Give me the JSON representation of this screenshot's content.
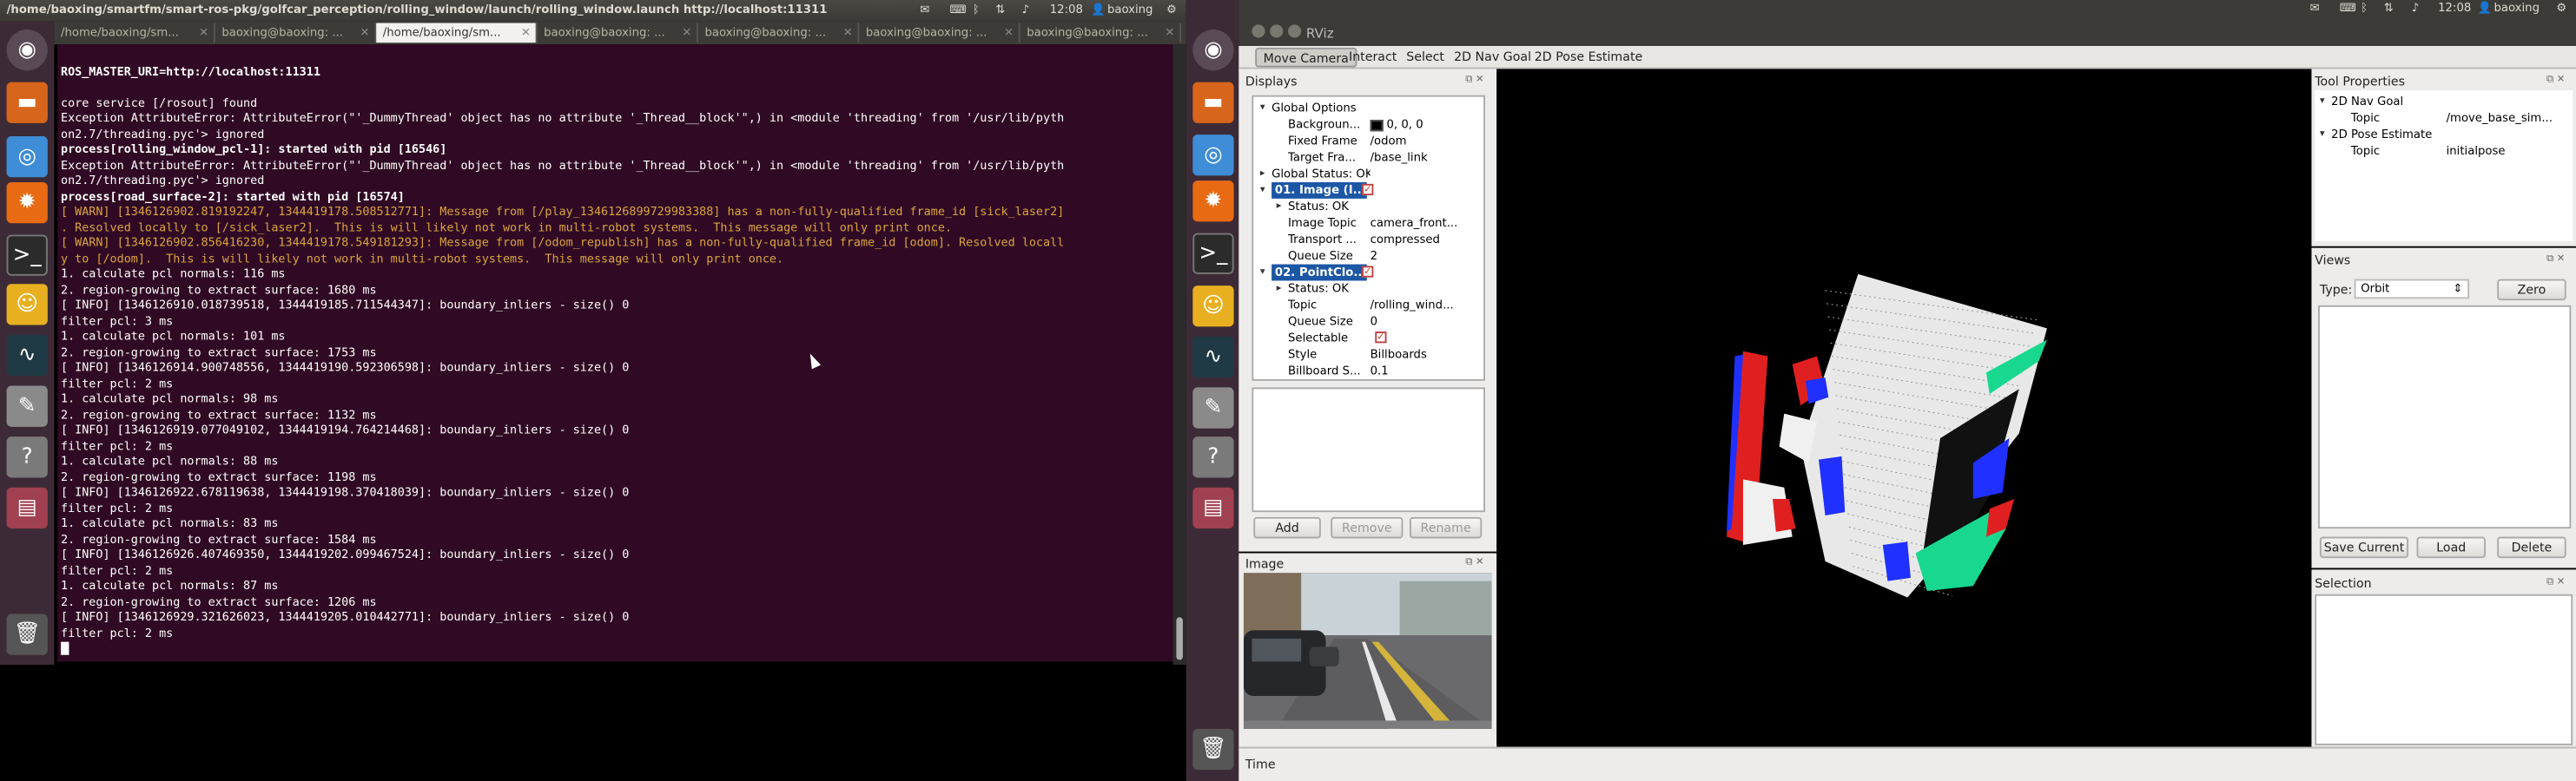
{
  "left_topbar": {
    "title": "/home/baoxing/smartfm/smart-ros-pkg/golfcar_perception/rolling_window/launch/rolling_window.launch http://localhost:11311",
    "time": "12:08",
    "user": "baoxing"
  },
  "right_topbar": {
    "time": "12:08",
    "user": "baoxing"
  },
  "terminal_tabs": [
    {
      "label": "/home/baoxing/sm..."
    },
    {
      "label": "baoxing@baoxing: ..."
    },
    {
      "label": "/home/baoxing/sm..."
    },
    {
      "label": "baoxing@baoxing: ..."
    },
    {
      "label": "baoxing@baoxing: ..."
    },
    {
      "label": "baoxing@baoxing: ..."
    },
    {
      "label": "baoxing@baoxing: ..."
    }
  ],
  "terminal_lines": [
    {
      "t": "",
      "s": ""
    },
    {
      "t": "ROS_MASTER_URI=http://localhost:11311",
      "s": "b"
    },
    {
      "t": "",
      "s": ""
    },
    {
      "t": "core service [/rosout] found",
      "s": ""
    },
    {
      "t": "Exception AttributeError: AttributeError(\"'_DummyThread' object has no attribute '_Thread__block'\",) in <module 'threading' from '/usr/lib/pyth",
      "s": ""
    },
    {
      "t": "on2.7/threading.pyc'> ignored",
      "s": ""
    },
    {
      "t": "process[rolling_window_pcl-1]: started with pid [16546]",
      "s": "b"
    },
    {
      "t": "Exception AttributeError: AttributeError(\"'_DummyThread' object has no attribute '_Thread__block'\",) in <module 'threading' from '/usr/lib/pyth",
      "s": ""
    },
    {
      "t": "on2.7/threading.pyc'> ignored",
      "s": ""
    },
    {
      "t": "process[road_surface-2]: started with pid [16574]",
      "s": "b"
    },
    {
      "t": "[ WARN] [1346126902.819192247, 1344419178.508512771]: Message from [/play_1346126899729983388] has a non-fully-qualified frame_id [sick_laser2]",
      "s": "w"
    },
    {
      "t": ". Resolved locally to [/sick_laser2].  This is will likely not work in multi-robot systems.  This message will only print once.",
      "s": "w"
    },
    {
      "t": "[ WARN] [1346126902.856416230, 1344419178.549181293]: Message from [/odom_republish] has a non-fully-qualified frame_id [odom]. Resolved locall",
      "s": "w"
    },
    {
      "t": "y to [/odom].  This is will likely not work in multi-robot systems.  This message will only print once.",
      "s": "w"
    },
    {
      "t": "1. calculate pcl normals: 116 ms",
      "s": ""
    },
    {
      "t": "2. region-growing to extract surface: 1680 ms",
      "s": ""
    },
    {
      "t": "[ INFO] [1346126910.018739518, 1344419185.711544347]: boundary_inliers - size() 0",
      "s": ""
    },
    {
      "t": "filter pcl: 3 ms",
      "s": ""
    },
    {
      "t": "1. calculate pcl normals: 101 ms",
      "s": ""
    },
    {
      "t": "2. region-growing to extract surface: 1753 ms",
      "s": ""
    },
    {
      "t": "[ INFO] [1346126914.900748556, 1344419190.592306598]: boundary_inliers - size() 0",
      "s": ""
    },
    {
      "t": "filter pcl: 2 ms",
      "s": ""
    },
    {
      "t": "1. calculate pcl normals: 98 ms",
      "s": ""
    },
    {
      "t": "2. region-growing to extract surface: 1132 ms",
      "s": ""
    },
    {
      "t": "[ INFO] [1346126919.077049102, 1344419194.764214468]: boundary_inliers - size() 0",
      "s": ""
    },
    {
      "t": "filter pcl: 2 ms",
      "s": ""
    },
    {
      "t": "1. calculate pcl normals: 88 ms",
      "s": ""
    },
    {
      "t": "2. region-growing to extract surface: 1198 ms",
      "s": ""
    },
    {
      "t": "[ INFO] [1346126922.678119638, 1344419198.370418039]: boundary_inliers - size() 0",
      "s": ""
    },
    {
      "t": "filter pcl: 2 ms",
      "s": ""
    },
    {
      "t": "1. calculate pcl normals: 83 ms",
      "s": ""
    },
    {
      "t": "2. region-growing to extract surface: 1584 ms",
      "s": ""
    },
    {
      "t": "[ INFO] [1346126926.407469350, 1344419202.099467524]: boundary_inliers - size() 0",
      "s": ""
    },
    {
      "t": "filter pcl: 2 ms",
      "s": ""
    },
    {
      "t": "1. calculate pcl normals: 87 ms",
      "s": ""
    },
    {
      "t": "2. region-growing to extract surface: 1206 ms",
      "s": ""
    },
    {
      "t": "[ INFO] [1346126929.321626023, 1344419205.010442771]: boundary_inliers - size() 0",
      "s": ""
    },
    {
      "t": "filter pcl: 2 ms",
      "s": ""
    }
  ],
  "rviz": {
    "window_title": "RViz",
    "tools": [
      "Move Camera",
      "Interact",
      "Select",
      "2D Nav Goal",
      "2D Pose Estimate"
    ],
    "displays": {
      "title": "Displays",
      "rows": [
        {
          "k": "Global Options",
          "v": "",
          "lvl": 0,
          "tri": "▾",
          "sel": false
        },
        {
          "k": "Backgroun...",
          "v": "0, 0, 0",
          "lvl": 1,
          "tri": "",
          "sel": false
        },
        {
          "k": "Fixed Frame",
          "v": "/odom",
          "lvl": 1,
          "tri": "",
          "sel": false
        },
        {
          "k": "Target Fra...",
          "v": "/base_link",
          "lvl": 1,
          "tri": "",
          "sel": false
        },
        {
          "k": "Global Status: OK",
          "v": "",
          "lvl": 0,
          "tri": "▸",
          "sel": false
        },
        {
          "k": "01. Image (I...",
          "v": "",
          "lvl": 0,
          "tri": "▾",
          "sel": true
        },
        {
          "k": "Status: OK",
          "v": "",
          "lvl": 1,
          "tri": "▸",
          "sel": false
        },
        {
          "k": "Image Topic",
          "v": "camera_front...",
          "lvl": 1,
          "tri": "",
          "sel": false
        },
        {
          "k": "Transport ...",
          "v": "compressed",
          "lvl": 1,
          "tri": "",
          "sel": false
        },
        {
          "k": "Queue Size",
          "v": "2",
          "lvl": 1,
          "tri": "",
          "sel": false
        },
        {
          "k": "02. PointClo...",
          "v": "",
          "lvl": 0,
          "tri": "▾",
          "sel": true
        },
        {
          "k": "Status: OK",
          "v": "",
          "lvl": 1,
          "tri": "▸",
          "sel": false
        },
        {
          "k": "Topic",
          "v": "/rolling_wind...",
          "lvl": 1,
          "tri": "",
          "sel": false
        },
        {
          "k": "Queue Size",
          "v": "0",
          "lvl": 1,
          "tri": "",
          "sel": false
        },
        {
          "k": "Selectable",
          "v": "",
          "lvl": 1,
          "tri": "",
          "sel": false
        },
        {
          "k": "Style",
          "v": "Billboards",
          "lvl": 1,
          "tri": "",
          "sel": false
        },
        {
          "k": "Billboard S...",
          "v": "0.1",
          "lvl": 1,
          "tri": "",
          "sel": false
        }
      ],
      "add": "Add",
      "remove": "Remove",
      "rename": "Rename"
    },
    "image_panel": {
      "title": "Image"
    },
    "tool_properties": {
      "title": "Tool Properties",
      "rows": [
        {
          "k": "2D Nav Goal",
          "v": "",
          "lvl": 0
        },
        {
          "k": "Topic",
          "v": "/move_base_sim...",
          "lvl": 1
        },
        {
          "k": "2D Pose Estimate",
          "v": "",
          "lvl": 0
        },
        {
          "k": "Topic",
          "v": "initialpose",
          "lvl": 1
        }
      ]
    },
    "views": {
      "title": "Views",
      "type_label": "Type:",
      "type_value": "Orbit",
      "zero": "Zero",
      "save": "Save Current",
      "load": "Load",
      "delete": "Delete"
    },
    "selection": {
      "title": "Selection"
    },
    "time": {
      "title": "Time"
    }
  }
}
